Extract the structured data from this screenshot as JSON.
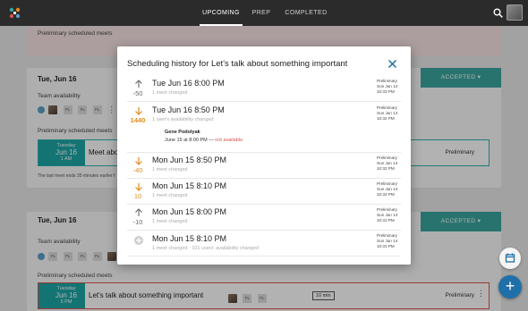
{
  "topbar": {
    "tabs": [
      {
        "label": "UPCOMING",
        "active": true
      },
      {
        "label": "PREP",
        "active": false
      },
      {
        "label": "COMPLETED",
        "active": false
      }
    ]
  },
  "background": {
    "top_card_prelim": "Preliminary scheduled meets",
    "card1": {
      "date": "Tue, Jun 16",
      "accepted_label": "ACCEPTED",
      "team_availability": "Team availability",
      "chips": [
        "FL",
        "FL",
        "FL"
      ],
      "prelim_label": "Preliminary scheduled meets",
      "meet": {
        "weekday": "Tuesday",
        "date": "Jun 16",
        "time": "1 AM",
        "title": "Meet abou",
        "status": "Preliminary"
      },
      "note": "The last meet ends 35 minutes earlier f"
    },
    "card2": {
      "date": "Tue, Jun 16",
      "accepted_label": "ACCEPTED",
      "team_availability": "Team availability",
      "chips": [
        "FL",
        "FL",
        "FL",
        "FL"
      ],
      "prelim_label": "Preliminary scheduled meets",
      "meet": {
        "weekday": "Tuesday",
        "date": "Jun 16",
        "time": "5 PM",
        "title": "Let's talk about something important",
        "chips": [
          "FL",
          "FL"
        ],
        "duration": "10 min",
        "status": "Preliminary"
      }
    }
  },
  "modal": {
    "title": "Scheduling history for Let's talk about something important",
    "entries": [
      {
        "direction": "up",
        "value": "-50",
        "when": "Tue Jun 16 8:00 PM",
        "sub": "1 meet changed",
        "stamp": [
          "Preliminary",
          "Sun Jun 14",
          "10:33 PM"
        ]
      },
      {
        "direction": "down",
        "value": "1440",
        "when": "Tue Jun 16 8:50 PM",
        "sub": "1 user's availability changed",
        "stamp": [
          "Preliminary",
          "Sun Jun 14",
          "10:32 PM"
        ],
        "detail": {
          "name": "Gene Podolyak",
          "line": "June 15 at 8:00 PM —",
          "na": "not available"
        }
      },
      {
        "direction": "down",
        "value": "-40",
        "when": "Mon Jun 15 8:50 PM",
        "sub": "1 meet changed",
        "stamp": [
          "Preliminary",
          "Sun Jun 14",
          "10:32 PM"
        ]
      },
      {
        "direction": "down",
        "value": "10",
        "when": "Mon Jun 15 8:10 PM",
        "sub": "1 meet changed",
        "stamp": [
          "Preliminary",
          "Sun Jun 14",
          "10:32 PM"
        ]
      },
      {
        "direction": "up",
        "value": "-10",
        "when": "Mon Jun 15 8:00 PM",
        "sub": "1 meet changed",
        "stamp": [
          "Preliminary",
          "Sun Jun 14",
          "10:31 PM"
        ]
      },
      {
        "direction": "plus",
        "value": "",
        "when": "Mon Jun 15 8:10 PM",
        "sub": "1 meet changed · 101 users' availability changed",
        "stamp": [
          "Preliminary",
          "Sun Jun 14",
          "10:31 PM"
        ]
      }
    ]
  },
  "colors": {
    "accent": "#3ba5a0",
    "up": "#666666",
    "down": "#e08a1e",
    "unavailable": "#d9534f",
    "topbar": "#2b2b2b"
  }
}
